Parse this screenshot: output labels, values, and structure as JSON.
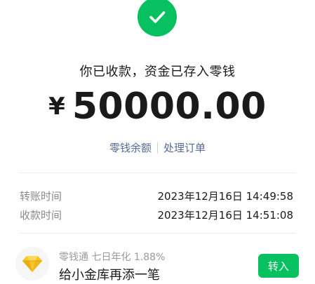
{
  "status": {
    "icon": "check-icon",
    "message": "你已收款，资金已存入零钱",
    "color": "#07c160"
  },
  "amount": {
    "currency": "¥",
    "value": "50000.00"
  },
  "links": {
    "balance": "零钱余额",
    "order": "处理订单",
    "color": "#576b95"
  },
  "details": [
    {
      "label": "转账时间",
      "value": "2023年12月16日 14:49:58"
    },
    {
      "label": "收款时间",
      "value": "2023年12月16日 14:51:08"
    }
  ],
  "promo": {
    "icon": "diamond-icon",
    "subtitle": "零钱通 七日年化 1.88%",
    "title": "给小金库再添一笔",
    "button": "转入"
  }
}
